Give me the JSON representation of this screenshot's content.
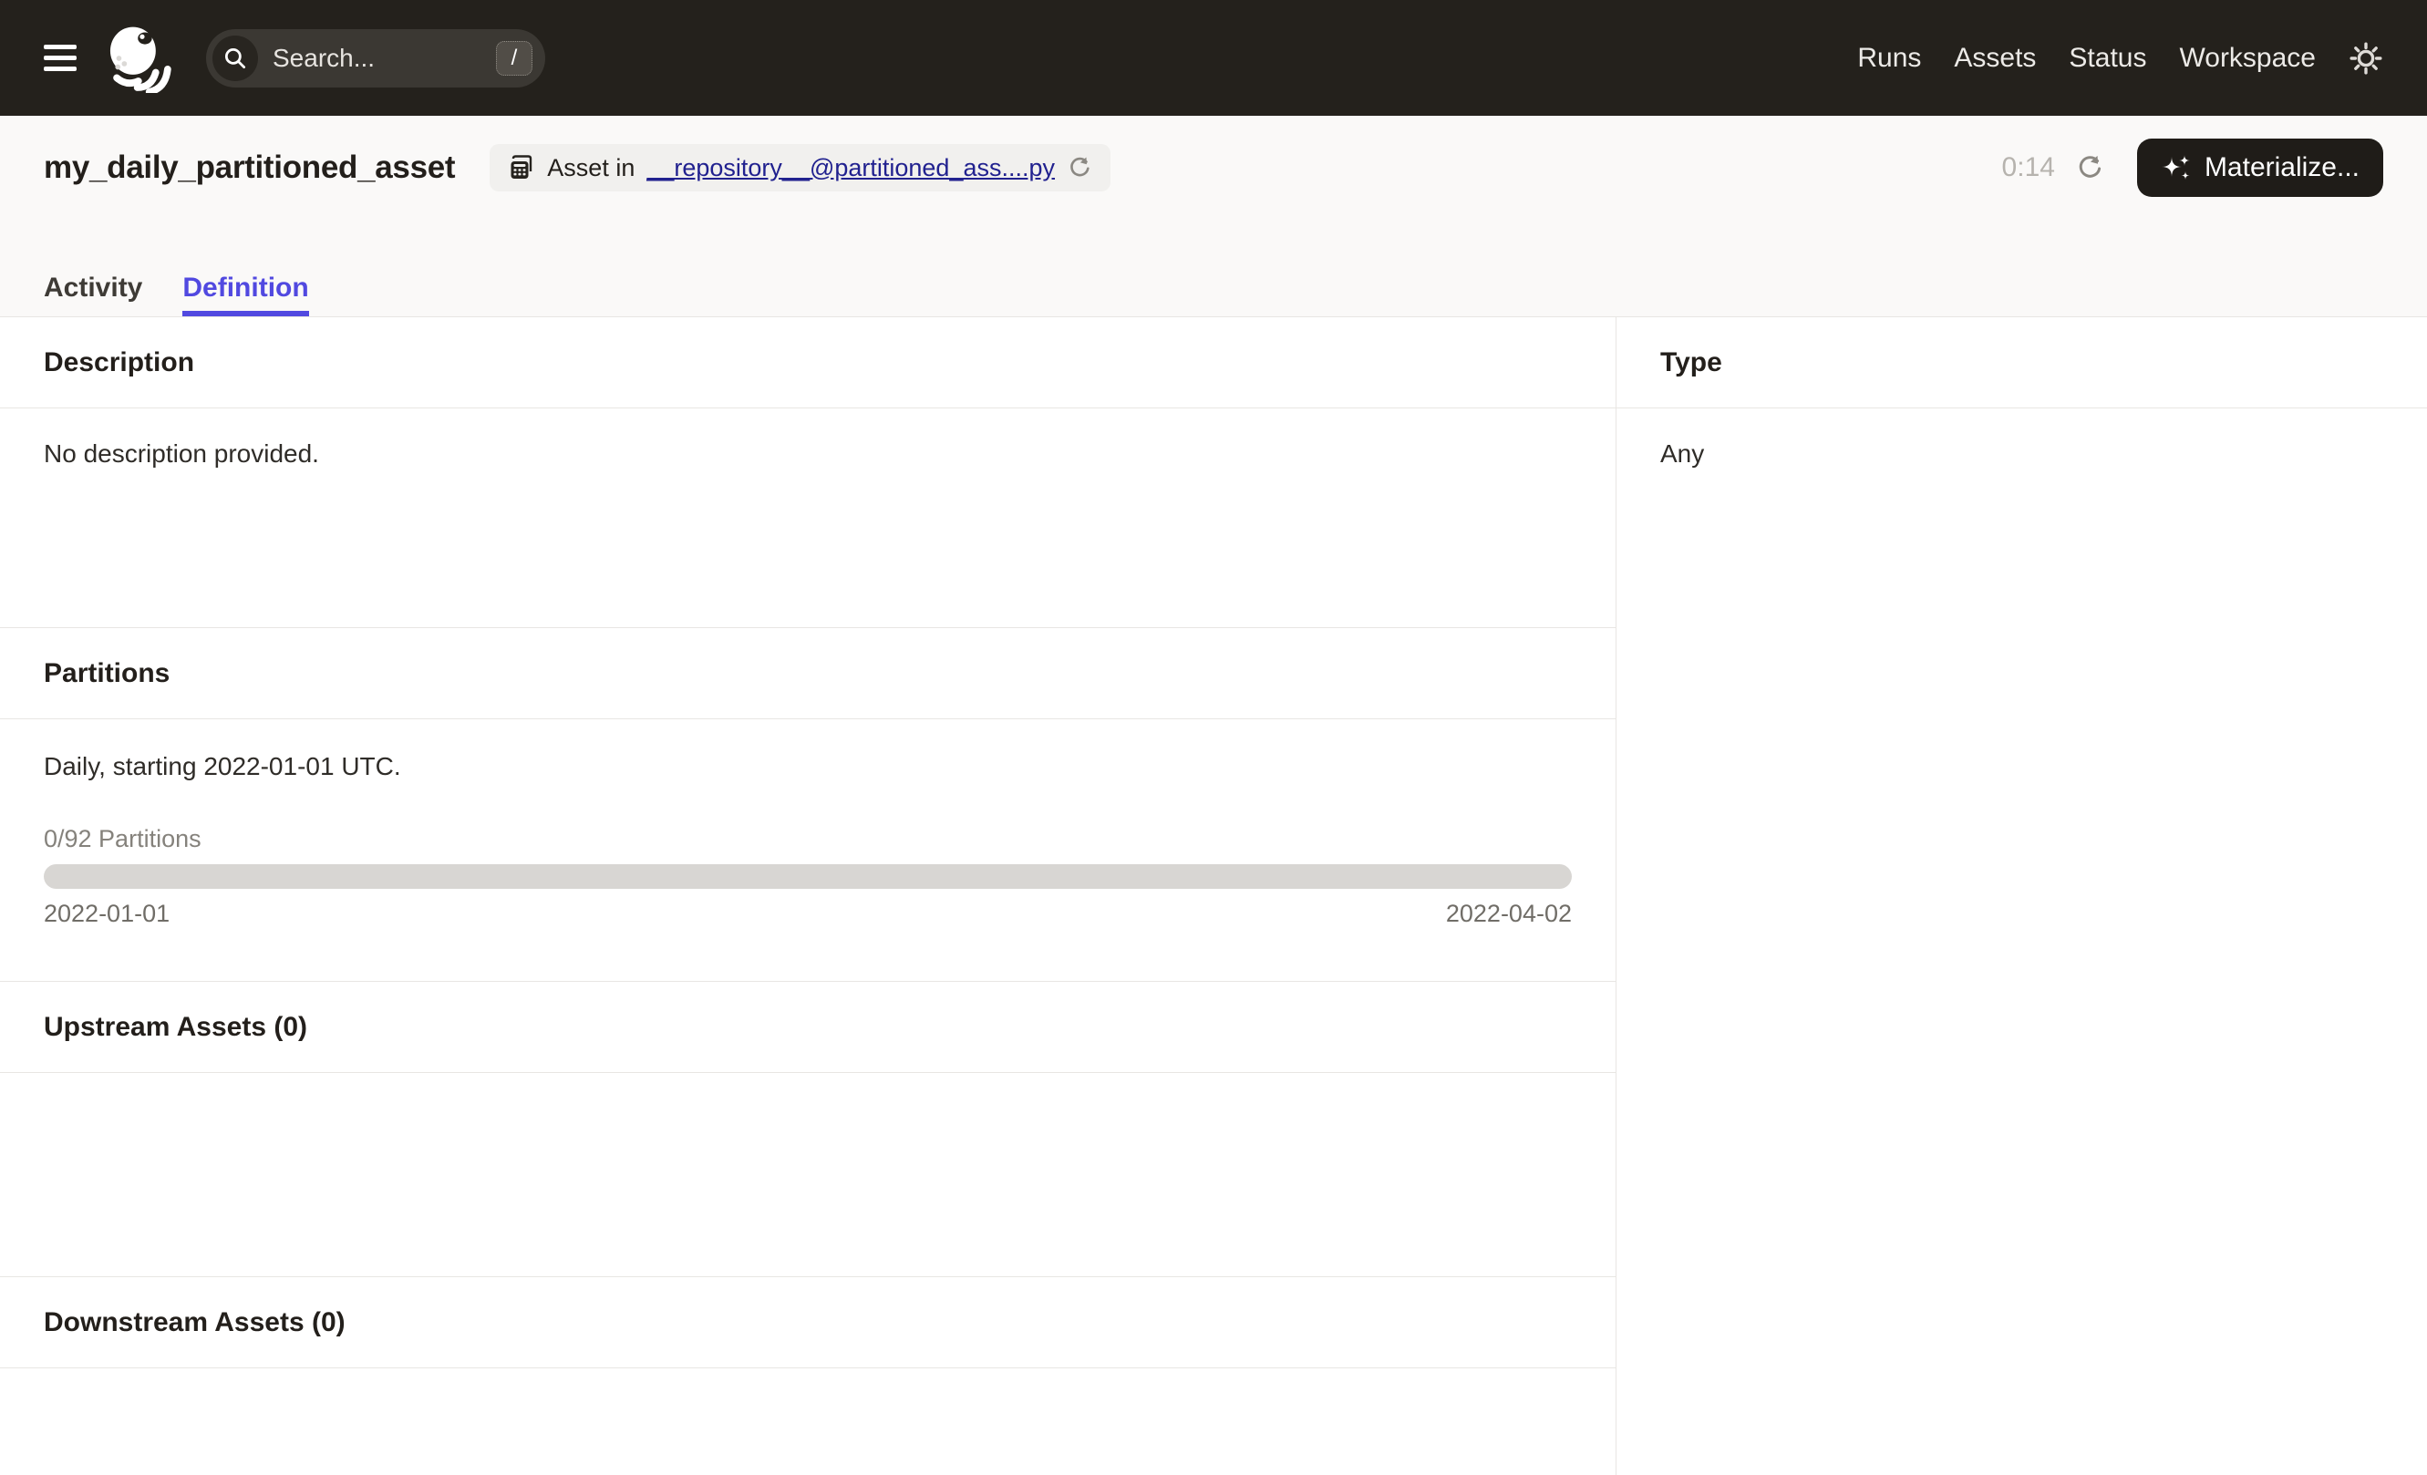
{
  "navbar": {
    "search": {
      "placeholder": "Search...",
      "shortcut_key": "/"
    },
    "links": [
      "Runs",
      "Assets",
      "Status",
      "Workspace"
    ]
  },
  "header": {
    "title": "my_daily_partitioned_asset",
    "badge": {
      "prefix": "Asset in",
      "link_text": "__repository__@partitioned_ass....py"
    },
    "refresh_timer": "0:14",
    "materialize_label": "Materialize..."
  },
  "tabs": [
    {
      "label": "Activity",
      "active": false
    },
    {
      "label": "Definition",
      "active": true
    }
  ],
  "left_sections": {
    "description": {
      "heading": "Description",
      "body": "No description provided."
    },
    "partitions": {
      "heading": "Partitions",
      "schedule_text": "Daily, starting 2022-01-01 UTC.",
      "progress_label": "0/92 Partitions",
      "progress_percent": 0,
      "range_start": "2022-01-01",
      "range_end": "2022-04-02"
    },
    "upstream": {
      "heading": "Upstream Assets (0)"
    },
    "downstream": {
      "heading": "Downstream Assets (0)"
    }
  },
  "right_sections": {
    "type": {
      "heading": "Type",
      "value": "Any"
    }
  },
  "colors": {
    "navbar_bg": "#24211C",
    "accent": "#5149E0",
    "link": "#21218F",
    "materialize_bg": "#1F1C18",
    "progress_track": "#D8D6D3",
    "border": "#E8E6E3"
  }
}
